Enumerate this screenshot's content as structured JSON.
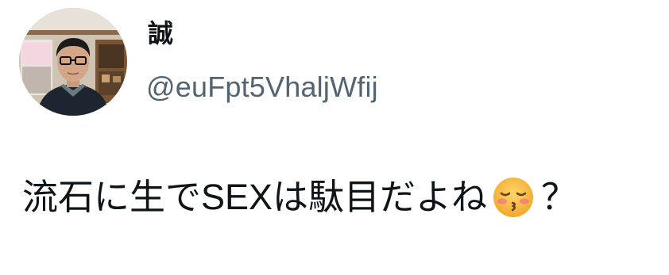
{
  "author": {
    "display_name": "誠",
    "handle": "@euFpt5VhaljWfij",
    "avatar": "profile-photo"
  },
  "tweet": {
    "text_before_emoji": "流石に生でSEXは駄目だよね",
    "emoji": "kissing-face-with-closed-eyes-emoji",
    "text_after_emoji": "？"
  },
  "colors": {
    "name": "#0f1419",
    "handle": "#536471",
    "text": "#0f1419"
  }
}
